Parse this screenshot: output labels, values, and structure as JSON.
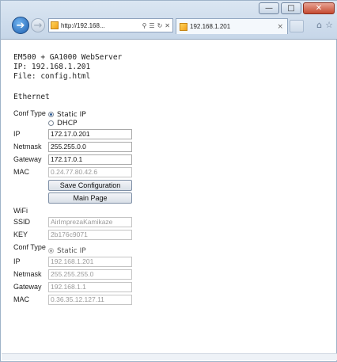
{
  "browser": {
    "address": "http://192.168...",
    "address_tools": [
      "search-icon",
      "refresh-icon",
      "stop-icon"
    ],
    "tab_title": "192.168.1.201",
    "window_buttons": [
      "minimize",
      "maximize",
      "close"
    ]
  },
  "header": {
    "line1": "EM500 + GA1000 WebServer",
    "line2": "IP: 192.168.1.201",
    "line3": "File: config.html"
  },
  "ethernet": {
    "title": "Ethernet",
    "conf_type_label": "Conf Type",
    "options": [
      {
        "label": "Static IP",
        "checked": true
      },
      {
        "label": "DHCP",
        "checked": false
      }
    ],
    "fields": [
      {
        "label": "IP",
        "value": "172.17.0.201",
        "disabled": false
      },
      {
        "label": "Netmask",
        "value": "255.255.0.0",
        "disabled": false
      },
      {
        "label": "Gateway",
        "value": "172.17.0.1",
        "disabled": false
      },
      {
        "label": "MAC",
        "value": "0.24.77.80.42.6",
        "disabled": true
      }
    ],
    "save_button": "Save Configuration",
    "main_button": "Main Page"
  },
  "wifi": {
    "title": "WiFi",
    "ssid_label": "SSID",
    "ssid_value": "AirImprezaKamikaze",
    "key_label": "KEY",
    "key_value": "2b176c9071",
    "conf_type_label": "Conf Type",
    "option_label": "Static IP",
    "fields": [
      {
        "label": "IP",
        "value": "192.168.1.201"
      },
      {
        "label": "Netmask",
        "value": "255.255.255.0"
      },
      {
        "label": "Gateway",
        "value": "192.168.1.1"
      },
      {
        "label": "MAC",
        "value": "0.36.35.12.127.11"
      }
    ]
  }
}
